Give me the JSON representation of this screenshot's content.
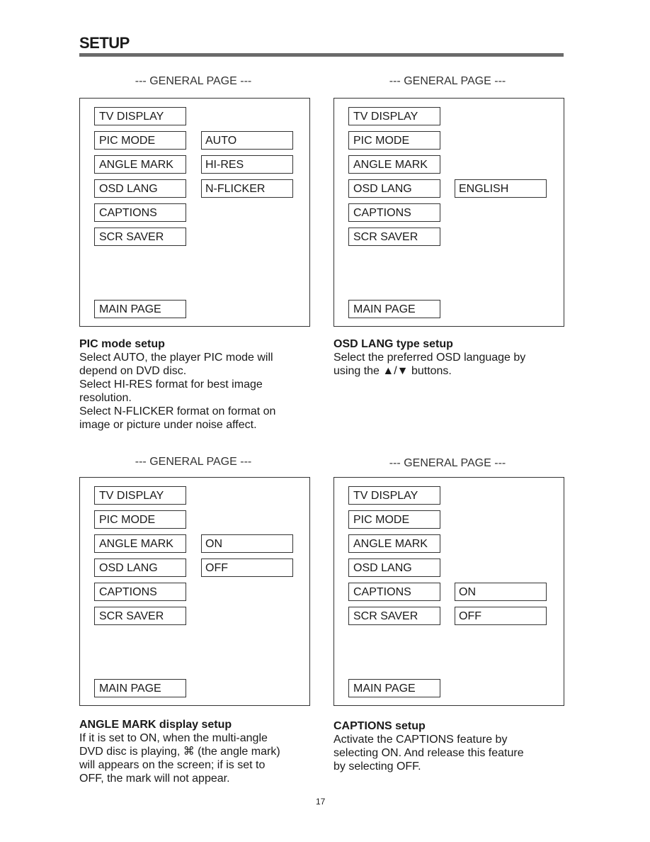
{
  "header": {
    "title": "SETUP"
  },
  "panels": [
    {
      "title": "--- GENERAL PAGE ---",
      "items": [
        "TV DISPLAY",
        "PIC MODE",
        "ANGLE MARK",
        "OSD LANG",
        "CAPTIONS",
        "SCR SAVER"
      ],
      "main": "MAIN PAGE",
      "options": [
        "AUTO",
        "HI-RES",
        "N-FLICKER"
      ],
      "desc_title": "PIC mode setup",
      "desc": [
        "Select AUTO, the player PIC mode will",
        "depend on DVD disc.",
        "Select HI-RES format for best image",
        "resolution.",
        "Select N-FLICKER format on format on",
        "image or picture under noise affect."
      ]
    },
    {
      "title": "--- GENERAL PAGE ---",
      "items": [
        "TV DISPLAY",
        "PIC MODE",
        "ANGLE MARK",
        "OSD LANG",
        "CAPTIONS",
        "SCR SAVER"
      ],
      "main": "MAIN PAGE",
      "options": [
        "ENGLISH"
      ],
      "desc_title": "OSD LANG type setup",
      "desc": [
        "Select the preferred OSD language by",
        "using the ▲/▼ buttons."
      ]
    },
    {
      "title": "--- GENERAL PAGE ---",
      "items": [
        "TV DISPLAY",
        "PIC MODE",
        "ANGLE MARK",
        "OSD LANG",
        "CAPTIONS",
        "SCR SAVER"
      ],
      "main": "MAIN PAGE",
      "options": [
        "ON",
        "OFF"
      ],
      "desc_title": "ANGLE MARK display setup",
      "desc": [
        "If it is set to ON, when the multi-angle",
        "DVD disc is playing, ⌘ (the angle mark)",
        "will appears on the screen; if is set to",
        "OFF, the mark will not appear."
      ]
    },
    {
      "title": "--- GENERAL PAGE ---",
      "items": [
        "TV DISPLAY",
        "PIC MODE",
        "ANGLE MARK",
        "OSD LANG",
        "CAPTIONS",
        "SCR SAVER"
      ],
      "main": "MAIN PAGE",
      "options": [
        "ON",
        "OFF"
      ],
      "desc_title": "CAPTIONS setup",
      "desc": [
        "Activate the CAPTIONS feature by",
        "selecting ON.  And release this feature",
        "by selecting OFF."
      ]
    }
  ],
  "page_number": "17"
}
